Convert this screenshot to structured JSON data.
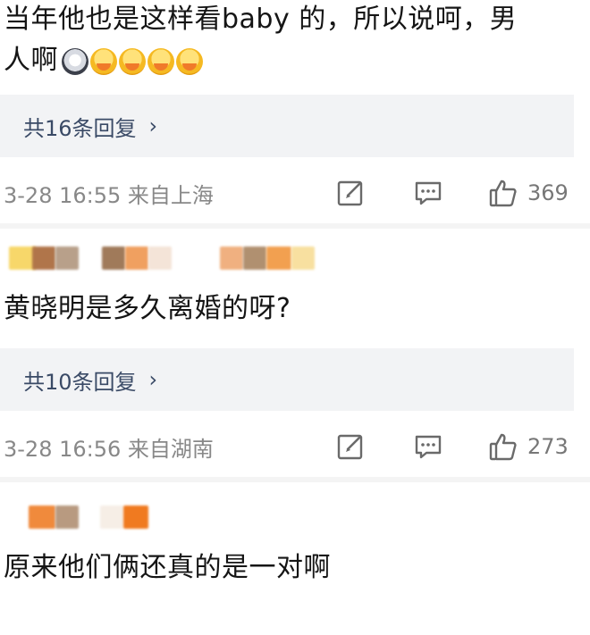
{
  "comments": [
    {
      "text_line1": "当年他也是这样看baby 的，所以说呵，男",
      "text_line2": "人啊",
      "emojis": [
        "shock-emoji",
        "hug-emoji",
        "hug-emoji",
        "hug-emoji",
        "hug-emoji"
      ],
      "reply_label": "共16条回复",
      "meta": "3-28 16:55 来自上海",
      "likes": "369"
    },
    {
      "text": "黄晓明是多久离婚的呀?",
      "reply_label": "共10条回复",
      "meta": "3-28 16:56 来自湖南",
      "likes": "273"
    },
    {
      "text": "原来他们俩还真的是一对啊"
    }
  ],
  "icons": {
    "edit": "edit-icon",
    "comment": "comment-icon",
    "like": "thumbs-up-icon",
    "chevron": "chevron-right-icon"
  },
  "chevron_glyph": "›",
  "colors": {
    "reply_box_bg": "#f2f3f5",
    "reply_text": "#3a4a66",
    "meta_text": "#888888",
    "censor_orange": "#f08a3c",
    "censor_brown": "#a97c5c",
    "censor_yellow": "#f7d76a"
  }
}
